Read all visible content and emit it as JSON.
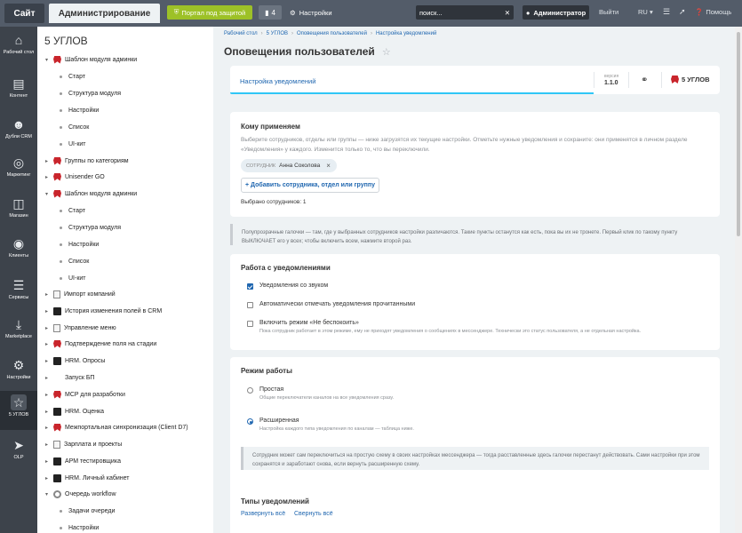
{
  "topbar": {
    "site_label": "Сайт",
    "admin_label": "Администрирование",
    "protect_label": "Портал под защитой",
    "count_value": "4",
    "settings_label": "Настройки",
    "search_placeholder": "поиск...",
    "user_label": "Администратор",
    "exit_label": "Выйти",
    "lang_label": "RU",
    "help_label": "Помощь"
  },
  "leftnav": [
    {
      "label": "Рабочий стол",
      "icon": "house-icon"
    },
    {
      "label": "Контент",
      "icon": "document-icon"
    },
    {
      "label": "Дубли CRM",
      "icon": "users-icon"
    },
    {
      "label": "Маркетинг",
      "icon": "target-icon"
    },
    {
      "label": "Магазин",
      "icon": "basket-icon"
    },
    {
      "label": "Клиенты",
      "icon": "clients-icon"
    },
    {
      "label": "Сервисы",
      "icon": "layers-icon"
    },
    {
      "label": "Marketplace",
      "icon": "download-icon"
    },
    {
      "label": "Настройки",
      "icon": "gear-icon"
    },
    {
      "label": "5 УГЛОВ",
      "icon": "module-icon"
    },
    {
      "label": "OLP",
      "icon": "arrow-circle-icon"
    }
  ],
  "tree": {
    "title": "5 УГЛОВ",
    "nodes": [
      {
        "label": "Шаблон модуля админки",
        "icon": "flag",
        "expanded": true
      },
      {
        "label": "Старт"
      },
      {
        "label": "Структура модуля"
      },
      {
        "label": "Настройки"
      },
      {
        "label": "Список"
      },
      {
        "label": "UI-кит"
      },
      {
        "label": "Группы по категориям",
        "icon": "flag"
      },
      {
        "label": "Unisender GO",
        "icon": "flag"
      },
      {
        "label": "Шаблон модуля админки",
        "icon": "flag",
        "expanded": true
      },
      {
        "label": "Старт"
      },
      {
        "label": "Структура модуля"
      },
      {
        "label": "Настройки"
      },
      {
        "label": "Список"
      },
      {
        "label": "UI-кит"
      },
      {
        "label": "Импорт компаний",
        "icon": "doc"
      },
      {
        "label": "История изменения полей в CRM",
        "icon": "dark"
      },
      {
        "label": "Управление меню",
        "icon": "list"
      },
      {
        "label": "Подтверждение поля на стадии",
        "icon": "flag"
      },
      {
        "label": "HRM. Опросы",
        "icon": "dark"
      },
      {
        "label": "Запуск БП"
      },
      {
        "label": "MCP для разработки",
        "icon": "flag"
      },
      {
        "label": "HRM. Оценка",
        "icon": "dark"
      },
      {
        "label": "Межпортальная синхронизация (Client D7)",
        "icon": "flag"
      },
      {
        "label": "Зарплата и проекты",
        "icon": "doc"
      },
      {
        "label": "АРМ тестировщика",
        "icon": "dark"
      },
      {
        "label": "HRM. Личный кабинет",
        "icon": "dark"
      },
      {
        "label": "Очередь workflow",
        "icon": "gear",
        "expanded": true
      },
      {
        "label": "Задачи очереди"
      },
      {
        "label": "Настройки"
      }
    ]
  },
  "breadcrumb": [
    "Рабочий стол",
    "5 УГЛОВ",
    "Оповещения пользователей",
    "Настройка уведомлений"
  ],
  "page_title": "Оповещения пользователей",
  "tabs": {
    "active_label": "Настройка уведомлений",
    "version_caption": "версия",
    "version_value": "1.1.0",
    "logo_text": "5 УГЛОВ"
  },
  "whom": {
    "title": "Кому применяем",
    "text": "Выберите сотрудников, отделы или группы — ниже загрузятся их текущие настройки. Отметьте нужные уведомления и сохраните: они применятся в личном разделе «Уведомления» у каждого. Изменится только то, что вы переключили.",
    "chip_caption": "СОТРУДНИК",
    "chip_name": "Анна Соколова",
    "add_button": "+ Добавить сотрудника, отдел или группу",
    "selected_text": "Выбрано сотрудников: 1"
  },
  "hint1": "Полупрозрачные галочки — там, где у выбранных сотрудников настройки различаются. Такие пункты останутся как есть, пока вы их не тронете. Первый клик по такому пункту ВЫКЛЮЧАЕТ его у всех; чтобы включить всем, нажмите второй раз.",
  "work": {
    "title": "Работа с уведомлениями",
    "options": [
      {
        "label": "Уведомления со звуком",
        "checked": true,
        "sub": ""
      },
      {
        "label": "Автоматически отмечать уведомления прочитанными",
        "checked": false,
        "sub": ""
      },
      {
        "label": "Включить режим «Не беспокоить»",
        "checked": false,
        "sub": "Пока сотрудник работает в этом режиме, ему не приходят уведомления о сообщениях в мессенджере. Технически это статус пользователя, а не отдельная настройка."
      }
    ]
  },
  "mode": {
    "title": "Режим работы",
    "options": [
      {
        "label": "Простая",
        "sub": "Общие переключатели каналов на все уведомления сразу.",
        "selected": false
      },
      {
        "label": "Расширенная",
        "sub": "Настройка каждого типа уведомления по каналам — таблица ниже.",
        "selected": true
      }
    ],
    "hint": "Сотрудник может сам переключиться на простую схему в своих настройках мессенджера — тогда расставленные здесь галочки перестанут действовать. Сами настройки при этом сохранятся и заработают снова, если вернуть расширенную схему."
  },
  "types": {
    "title": "Типы уведомлений",
    "expand_all": "Развернуть всё",
    "collapse_all": "Свернуть всё"
  }
}
